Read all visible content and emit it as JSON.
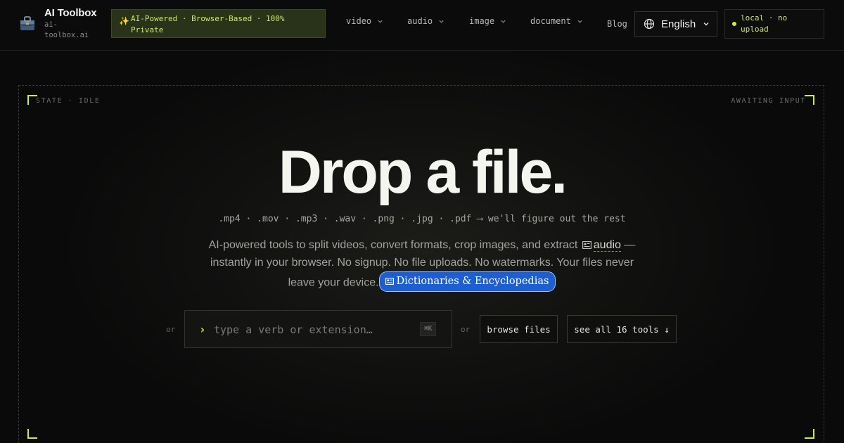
{
  "header": {
    "brand_name": "AI Toolbox",
    "brand_domain": "ai-toolbox.ai",
    "promo_icon": "sparkles-icon",
    "promo_text": "AI-Powered · Browser-Based · 100% Private",
    "nav": [
      {
        "label": "video"
      },
      {
        "label": "audio"
      },
      {
        "label": "image"
      },
      {
        "label": "document"
      }
    ],
    "blog_label": "Blog",
    "language": "English",
    "status_text": "local · no upload",
    "accent_color": "#c8f03a"
  },
  "stage": {
    "state_label": "STATE · IDLE",
    "awaiting_label": "AWAITING INPUT",
    "headline": "Drop a file.",
    "formats": ".mp4 · .mov · .mp3 · .wav · .png · .jpg · .pdf ⟶ we'll figure out the rest",
    "desc_part1": "AI-powered tools to split videos, convert formats, crop images, and extract",
    "desc_link": "audio",
    "desc_part2": "— instantly in your browser. No signup. No file uploads. No watermarks. Your files never leave your device.",
    "pill_label": "Dictionaries & Encyclopedias"
  },
  "actions": {
    "or_label": "or",
    "search_placeholder": "type a verb or extension…",
    "search_value": "",
    "shortcut": "⌘K",
    "browse_label": "browse files",
    "tools_label": "see all 16 tools ↓"
  }
}
